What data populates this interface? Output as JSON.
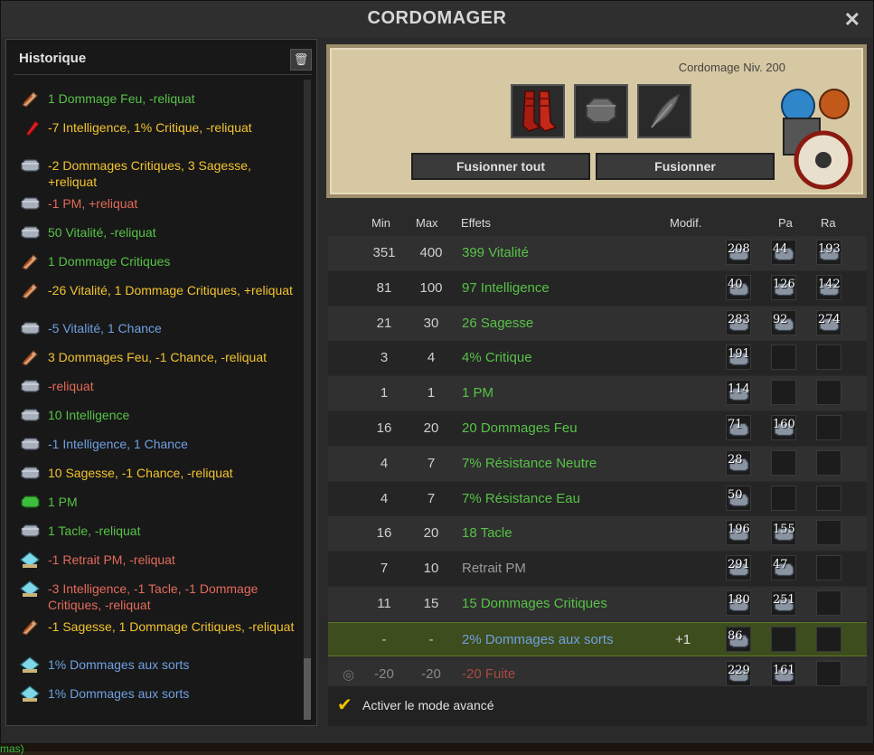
{
  "window": {
    "title": "CORDOMAGER"
  },
  "history": {
    "title": "Historique",
    "items": [
      {
        "text": "1 Dommage Feu, -reliquat",
        "color": "#57c247",
        "icon": "fire-rune-icon"
      },
      {
        "text": "-7 Intelligence, 1% Critique, -reliquat",
        "color": "#f2c330",
        "icon": "crit-rune-icon"
      },
      {
        "text": "-2 Dommages Critiques, 3 Sagesse, +reliquat",
        "color": "#f2c330",
        "icon": "rune-icon"
      },
      {
        "text": "-1 PM, +reliquat",
        "color": "#e36a5a",
        "icon": "rune-icon"
      },
      {
        "text": "50 Vitalité, -reliquat",
        "color": "#57c247",
        "icon": "rune-icon"
      },
      {
        "text": "1 Dommage Critiques",
        "color": "#57c247",
        "icon": "fire-rune-icon"
      },
      {
        "text": "-26 Vitalité, 1 Dommage Critiques, +reliquat",
        "color": "#f2c330",
        "icon": "fire-rune-icon"
      },
      {
        "text": "-5 Vitalité, 1 Chance",
        "color": "#6fa0e0",
        "icon": "rune-icon"
      },
      {
        "text": "3 Dommages Feu, -1 Chance, -reliquat",
        "color": "#f2c330",
        "icon": "fire-rune-icon"
      },
      {
        "text": "-reliquat",
        "color": "#e36a5a",
        "icon": "rune-icon"
      },
      {
        "text": "10 Intelligence",
        "color": "#57c247",
        "icon": "rune-icon"
      },
      {
        "text": "-1 Intelligence, 1 Chance",
        "color": "#6fa0e0",
        "icon": "rune-icon"
      },
      {
        "text": "10 Sagesse, -1 Chance, -reliquat",
        "color": "#f2c330",
        "icon": "rune-icon"
      },
      {
        "text": "1 PM",
        "color": "#57c247",
        "icon": "green-rune-icon"
      },
      {
        "text": "1 Tacle, -reliquat",
        "color": "#57c247",
        "icon": "rune-icon"
      },
      {
        "text": "-1 Retrait PM, -reliquat",
        "color": "#e36a5a",
        "icon": "orb-rune-icon"
      },
      {
        "text": "-3 Intelligence, -1 Tacle, -1 Dommage Critiques, -reliquat",
        "color": "#e36a5a",
        "icon": "orb-rune-icon"
      },
      {
        "text": "-1 Sagesse, 1 Dommage Critiques, -reliquat",
        "color": "#f2c330",
        "icon": "fire-rune-icon"
      },
      {
        "text": "1% Dommages aux sorts",
        "color": "#6fa0e0",
        "icon": "orb-rune-icon"
      },
      {
        "text": "1% Dommages aux sorts",
        "color": "#6fa0e0",
        "icon": "orb-rune-icon"
      }
    ]
  },
  "craft": {
    "level_label": "Cordomage Niv. 200",
    "fuse_all_label": "Fusionner tout",
    "fuse_label": "Fusionner"
  },
  "table": {
    "headers": {
      "min": "Min",
      "max": "Max",
      "effects": "Effets",
      "modif": "Modif.",
      "pa": "Pa",
      "ra": "Ra"
    },
    "rows": [
      {
        "min": "351",
        "max": "400",
        "effect": "399 Vitalité",
        "color": "#57c247",
        "modif": "",
        "runes": [
          "208",
          "44",
          "193"
        ]
      },
      {
        "min": "81",
        "max": "100",
        "effect": "97 Intelligence",
        "color": "#57c247",
        "modif": "",
        "runes": [
          "40",
          "126",
          "142"
        ]
      },
      {
        "min": "21",
        "max": "30",
        "effect": "26 Sagesse",
        "color": "#57c247",
        "modif": "",
        "runes": [
          "283",
          "92",
          "274"
        ]
      },
      {
        "min": "3",
        "max": "4",
        "effect": "4% Critique",
        "color": "#57c247",
        "modif": "",
        "runes": [
          "191",
          "",
          ""
        ]
      },
      {
        "min": "1",
        "max": "1",
        "effect": "1 PM",
        "color": "#57c247",
        "modif": "",
        "runes": [
          "114",
          "",
          ""
        ]
      },
      {
        "min": "16",
        "max": "20",
        "effect": "20 Dommages Feu",
        "color": "#57c247",
        "modif": "",
        "runes": [
          "71",
          "160",
          ""
        ]
      },
      {
        "min": "4",
        "max": "7",
        "effect": "7% Résistance Neutre",
        "color": "#57c247",
        "modif": "",
        "runes": [
          "28",
          "",
          ""
        ]
      },
      {
        "min": "4",
        "max": "7",
        "effect": "7% Résistance Eau",
        "color": "#57c247",
        "modif": "",
        "runes": [
          "50",
          "",
          ""
        ]
      },
      {
        "min": "16",
        "max": "20",
        "effect": "18 Tacle",
        "color": "#57c247",
        "modif": "",
        "runes": [
          "196",
          "155",
          ""
        ]
      },
      {
        "min": "7",
        "max": "10",
        "effect": "Retrait PM",
        "color": "#9a9a9a",
        "modif": "",
        "runes": [
          "291",
          "47",
          ""
        ]
      },
      {
        "min": "11",
        "max": "15",
        "effect": "15 Dommages Critiques",
        "color": "#57c247",
        "modif": "",
        "runes": [
          "180",
          "251",
          ""
        ]
      },
      {
        "min": "-",
        "max": "-",
        "effect": "2% Dommages aux sorts",
        "color": "#6fa0e0",
        "modif": "+1",
        "runes": [
          "86",
          "",
          ""
        ]
      },
      {
        "min": "-20",
        "max": "-20",
        "effect": "-20 Fuite",
        "color": "#a84b3f",
        "modif": "",
        "runes": [
          "229",
          "161",
          ""
        ]
      }
    ]
  },
  "advanced_mode_label": "Activer le mode avancé",
  "footer_text": "mas)"
}
